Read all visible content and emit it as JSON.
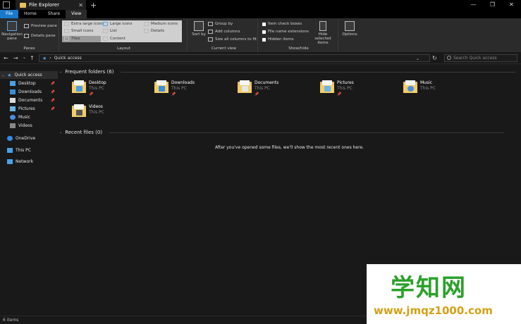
{
  "titlebar": {
    "title": "File Explorer",
    "close_tab": "✕",
    "new_tab": "+",
    "minimize": "—",
    "maximize": "❐",
    "close": "✕"
  },
  "ribbon_tabs": [
    "File",
    "Home",
    "Share",
    "View"
  ],
  "panes": {
    "label": "Panes",
    "navigation_pane": "Navigation pane",
    "preview_pane": "Preview pane",
    "details_pane": "Details pane"
  },
  "layout": {
    "label": "Layout",
    "options": [
      "Extra large icons",
      "Large icons",
      "Medium icons",
      "Small icons",
      "List",
      "Details",
      "Tiles",
      "Content"
    ],
    "selected": "Tiles"
  },
  "current_view": {
    "label": "Current view",
    "sort_by": "Sort by",
    "group_by": "Group by",
    "add_columns": "Add columns",
    "size_columns": "Size all columns to fit"
  },
  "show_hide": {
    "label": "Show/hide",
    "item_check_boxes": "Item check boxes",
    "file_name_extensions": "File name extensions",
    "hidden_items": "Hidden items",
    "hide_selected": "Hide selected items"
  },
  "options": "Options",
  "address": {
    "back": "←",
    "forward": "→",
    "dropdown": "⌄",
    "up": "↑",
    "separator": "›",
    "path": "Quick access",
    "search_placeholder": "Search Quick access"
  },
  "sidebar": {
    "quick_access": "Quick access",
    "items": [
      "Desktop",
      "Downloads",
      "Documents",
      "Pictures",
      "Music",
      "Videos"
    ],
    "onedrive": "OneDrive",
    "this_pc": "This PC",
    "network": "Network"
  },
  "frequent": {
    "header": "Frequent folders (6)",
    "folders": [
      {
        "name": "Desktop",
        "location": "This PC"
      },
      {
        "name": "Downloads",
        "location": "This PC"
      },
      {
        "name": "Documents",
        "location": "This PC"
      },
      {
        "name": "Pictures",
        "location": "This PC"
      },
      {
        "name": "Music",
        "location": "This PC"
      },
      {
        "name": "Videos",
        "location": "This PC"
      }
    ]
  },
  "recent": {
    "header": "Recent files (0)",
    "empty_message": "After you've opened some files, we'll show the most recent ones here."
  },
  "status": {
    "item_count": "6 items"
  },
  "watermark": {
    "logo": "学知网",
    "url": "www.jmqz1000.com"
  },
  "colors": {
    "accent": "#1979ca",
    "folder": "#e8c062",
    "background": "#191919",
    "ribbon": "#2b2b2b"
  }
}
